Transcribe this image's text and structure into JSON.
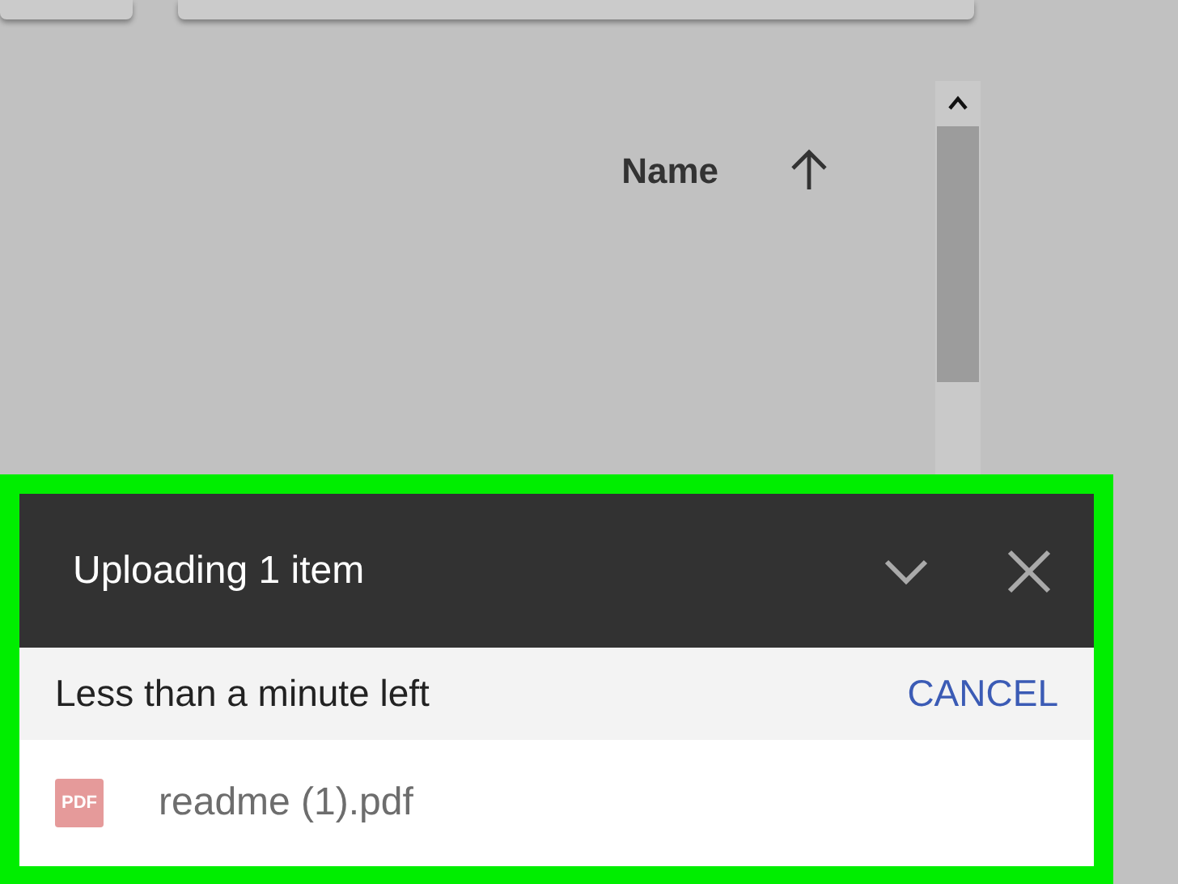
{
  "list_header": {
    "column": "Name",
    "sort_ascending": true
  },
  "upload_panel": {
    "title": "Uploading 1 item",
    "status": "Less than a minute left",
    "cancel": "CANCEL",
    "files": [
      {
        "icon_label": "PDF",
        "name": "readme (1).pdf"
      }
    ]
  }
}
